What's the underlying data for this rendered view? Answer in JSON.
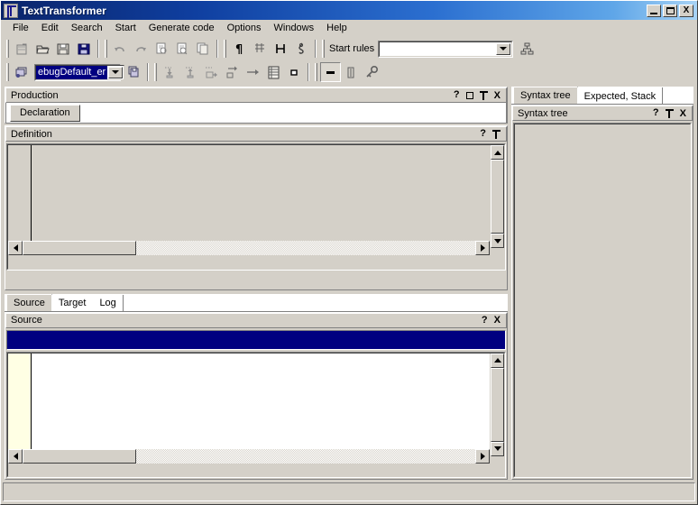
{
  "window": {
    "title": "TextTransformer",
    "icon": "app-icon",
    "buttons": {
      "minimize": "_",
      "maximize": "□",
      "close": "X"
    }
  },
  "menu": {
    "items": [
      "File",
      "Edit",
      "Search",
      "Start",
      "Generate code",
      "Options",
      "Windows",
      "Help"
    ]
  },
  "toolbar1": {
    "groups": [
      {
        "icons": [
          "new-project-icon",
          "open-folder-icon",
          "save-icon",
          "save-all-icon"
        ]
      },
      {
        "icons": [
          "undo-icon",
          "redo-icon",
          "copy-icon",
          "paste-icon",
          "duplicate-icon"
        ]
      },
      {
        "icons": [
          "pilcrow-icon",
          "table-icon",
          "measure-icon",
          "treble-clef-icon"
        ]
      }
    ],
    "start_rules_label": "Start rules",
    "start_rules_value": "",
    "start_rules_placeholder": "",
    "tree_button_icon": "hierarchy-icon"
  },
  "toolbar2": {
    "grammar_icon": "layers-icon",
    "combo_value": "ebugDefault_er",
    "combo_selected": true,
    "save_grammar_icon": "save-grammar-icon",
    "icons": [
      "step-into-icon",
      "step-out-icon",
      "step-over-icon",
      "step-next-icon",
      "run-to-cursor-icon",
      "list-icon",
      "stop-icon"
    ],
    "toggled_icon": "breakpoint-icon",
    "icons_tail": [
      "text-cursor-icon",
      "key-icon"
    ]
  },
  "production_panel": {
    "caption": "Production",
    "cap_buttons": [
      "help-icon",
      "maximize-icon",
      "pin-icon",
      "close-icon"
    ],
    "declaration_button": "Declaration",
    "declaration_value": ""
  },
  "definition_panel": {
    "caption": "Definition",
    "cap_buttons": [
      "help-icon",
      "pin-icon"
    ],
    "content": ""
  },
  "bottom_tabs": {
    "tabs": [
      {
        "label": "Source",
        "active": true
      },
      {
        "label": "Target",
        "active": false
      },
      {
        "label": "Log",
        "active": false
      }
    ]
  },
  "source_panel": {
    "caption": "Source",
    "cap_buttons": [
      "help-icon",
      "close-icon"
    ],
    "content": "",
    "selection_bar_color": "#000080"
  },
  "right_tabs": {
    "tabs": [
      {
        "label": "Syntax tree",
        "active": true
      },
      {
        "label": "Expected, Stack",
        "active": false
      }
    ]
  },
  "syntax_tree_panel": {
    "caption": "Syntax tree",
    "cap_buttons": [
      "help-icon",
      "pin-icon",
      "close-icon"
    ],
    "content": ""
  },
  "statusbar": {
    "text": ""
  },
  "colors": {
    "face": "#d4d0c8",
    "title_start": "#0a246a",
    "title_end": "#a8d3f5",
    "selection": "#000080",
    "gutter": "#ffffe4",
    "editor_disabled": "#d4d0c8"
  }
}
